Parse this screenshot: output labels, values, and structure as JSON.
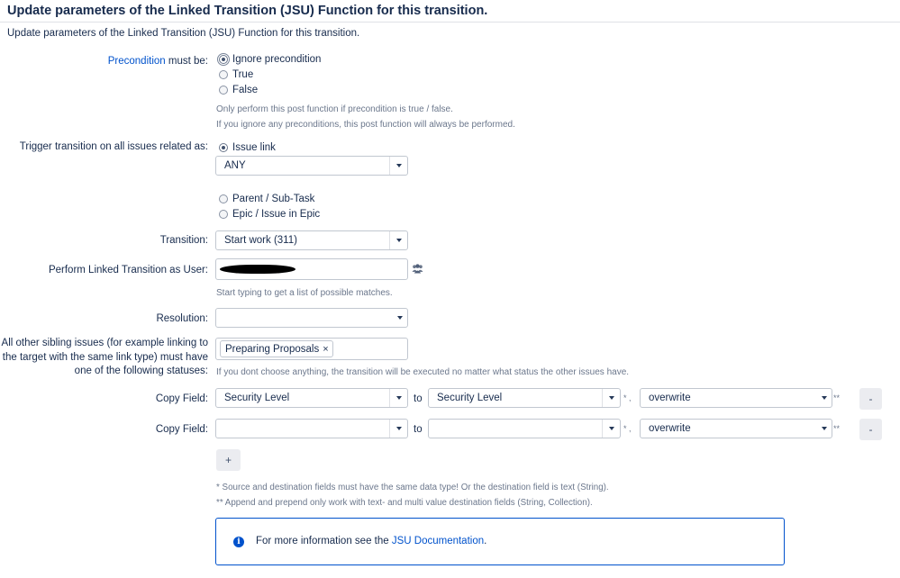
{
  "header": {
    "title": "Update parameters of the Linked Transition (JSU) Function for this transition.",
    "subtitle": "Update parameters of the Linked Transition (JSU) Function for this transition."
  },
  "precondition": {
    "label_link": "Precondition",
    "label_rest": " must be:",
    "options": [
      "Ignore precondition",
      "True",
      "False"
    ],
    "selected": "Ignore precondition",
    "help_1": "Only perform this post function if precondition is true / false.",
    "help_2": "If you ignore any preconditions, this post function will always be performed."
  },
  "trigger": {
    "label": "Trigger transition on all issues related as:",
    "options": [
      "Issue link",
      "Parent / Sub-Task",
      "Epic / Issue in Epic"
    ],
    "selected": "Issue link",
    "link_type_value": "ANY"
  },
  "transition": {
    "label": "Transition:",
    "value": "Start work (311)"
  },
  "perform_as_user": {
    "label": "Perform Linked Transition as User:",
    "help": "Start typing to get a list of possible matches.",
    "icon": "users-icon"
  },
  "resolution": {
    "label": "Resolution:",
    "value": ""
  },
  "sibling_statuses": {
    "label_line_1": "All other sibling issues (for example linking to",
    "label_line_2": "the target with the same link type) must have",
    "label_line_3": "one of the following statuses:",
    "selected_status": "Preparing Proposals",
    "remove_glyph": "×",
    "help": "If you dont choose anything, the transition will be executed no matter what status the other issues have."
  },
  "copy_fields": [
    {
      "label": "Copy Field:",
      "source": "Security Level",
      "to_label": "to",
      "destination": "Security Level",
      "star": "* ,",
      "mode": "overwrite",
      "double_star": "**",
      "remove_label": "-"
    },
    {
      "label": "Copy Field:",
      "source": "",
      "to_label": "to",
      "destination": "",
      "star": "* ,",
      "mode": "overwrite",
      "double_star": "**",
      "remove_label": "-"
    }
  ],
  "add_button_label": "+",
  "notes": {
    "note_1": "* Source and destination fields must have the same data type! Or the destination field is text (String).",
    "note_2": "** Append and prepend only work with text- and multi value destination fields (String, Collection)."
  },
  "info": {
    "text": "For more information see the ",
    "link": "JSU Documentation",
    "suffix": ".",
    "accent_color": "#0052cc"
  }
}
